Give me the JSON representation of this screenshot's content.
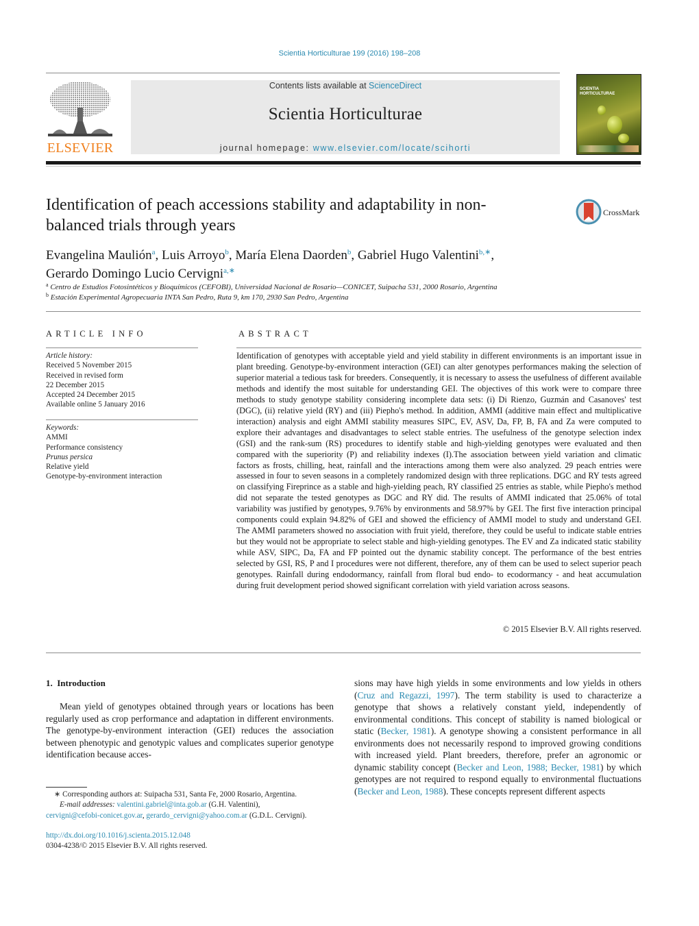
{
  "header": {
    "journal_reference": "Scientia Horticulturae 199 (2016) 198–208",
    "contents_prefix": "Contents lists available at ",
    "contents_link": "ScienceDirect",
    "journal_title": "Scientia Horticulturae",
    "homepage_prefix": "journal homepage: ",
    "homepage_link": "www.elsevier.com/locate/scihorti",
    "publisher_logo_text": "ELSEVIER",
    "cover_title": "SCIENTIA HORTICULTURAE",
    "brand_color": "#f07f1b",
    "link_color": "#2a8ab0"
  },
  "article": {
    "title": "Identification of peach accessions stability and adaptability in non-balanced trials through years",
    "crossmark_label": "CrossMark",
    "authors": [
      {
        "name": "Evangelina Maulión",
        "sup": "a"
      },
      {
        "name": "Luis Arroyo",
        "sup": "b"
      },
      {
        "name": "María Elena Daorden",
        "sup": "b"
      },
      {
        "name": "Gabriel Hugo Valentini",
        "sup": "b,∗"
      },
      {
        "name": "Gerardo Domingo Lucio Cervigni",
        "sup": "a,∗"
      }
    ],
    "affiliations": [
      {
        "mark": "a",
        "text": "Centro de Estudios Fotosintéticos y Bioquímicos (CEFOBI), Universidad Nacional de Rosario—CONICET, Suipacha 531, 2000 Rosario, Argentina"
      },
      {
        "mark": "b",
        "text": "Estación Experimental Agropecuaria INTA San Pedro, Ruta 9, km 170, 2930 San Pedro, Argentina"
      }
    ]
  },
  "article_info": {
    "heading": "ARTICLE INFO",
    "history_label": "Article history:",
    "history": [
      "Received 5 November 2015",
      "Received in revised form",
      "22 December 2015",
      "Accepted 24 December 2015",
      "Available online 5 January 2016"
    ],
    "keywords_label": "Keywords:",
    "keywords": [
      {
        "text": "AMMI",
        "italic": false
      },
      {
        "text": "Performance consistency",
        "italic": false
      },
      {
        "text": "Prunus persica",
        "italic": true
      },
      {
        "text": "Relative yield",
        "italic": false
      },
      {
        "text": "Genotype-by-environment interaction",
        "italic": false
      }
    ]
  },
  "abstract": {
    "heading": "ABSTRACT",
    "text": "Identification of genotypes with acceptable yield and yield stability in different environments is an important issue in plant breeding. Genotype-by-environment interaction (GEI) can alter genotypes per­formances making the selection of superior material a tedious task for breeders. Consequently, it is necessary to assess the usefulness of different available methods and identify the most suitable for under­standing GEI. The objectives of this work were to compare three methods to study genotype stability considering incomplete data sets: (i) Di Rienzo, Guzmán and Casanoves' test (DGC), (ii) relative yield (RY) and (iii) Piepho's method. In addition, AMMI (additive main effect and multiplicative interaction) analysis and eight AMMI stability measures SIPC, EV, ASV, Da, FP, B, FA and Za were computed to explore their advantages and disadvantages to select stable entries. The usefulness of the genotype selection index (GSI) and the rank-sum (RS) procedures to identify stable and high-yielding genotypes were evaluated and then compared with the superiority (P) and reliability indexes (I).The association between yield vari­ation and climatic factors as frosts, chilling, heat, rainfall and the interactions among them were also analyzed. 29 peach entries were assessed in four to seven seasons in a completely randomized design with three replications. DGC and RY tests agreed on classifying Fireprince as a stable and high-yielding peach, RY classified 25 entries as stable, while Piepho's method did not separate the tested genotypes as DGC and RY did. The results of AMMI indicated that 25.06% of total variability was justified by genotypes, 9.76% by environments and 58.97% by GEI. The first five interaction principal components could explain 94.82% of GEI and showed the efficiency of AMMI model to study and understand GEI. The AMMI param­eters showed no association with fruit yield, therefore, they could be useful to indicate stable entries but they would not be appropriate to select stable and high-yielding genotypes. The EV and Za indicated static stability while ASV, SIPC, Da, FA and FP pointed out the dynamic stability concept. The performance of the best entries selected by GSI, RS, P and I procedures were not different, therefore, any of them can be used to select superior peach genotypes. Rainfall during endodormancy, rainfall from floral bud endo- to ecodormancy - and heat accumulation during fruit development period showed significant correlation with yield variation across seasons.",
    "copyright": "© 2015 Elsevier B.V. All rights reserved."
  },
  "introduction": {
    "heading": "1.  Introduction",
    "left_column": "Mean yield of genotypes obtained through years or locations has been regularly used as crop performance and adaptation in differ­ent environments. The genotype-by-environment interaction (GEI) reduces the association between phenotypic and genotypic values and complicates superior genotype identification because acces-",
    "right_column": [
      {
        "t": "sions may have high yields in some environments and low yields in others ("
      },
      {
        "t": "Cruz and Regazzi, 1997",
        "link": true
      },
      {
        "t": "). The term stability is used to characterize a genotype that shows a relatively constant yield, inde­pendently of environmental conditions. This concept of stability is named biological or static ("
      },
      {
        "t": "Becker, 1981",
        "link": true
      },
      {
        "t": "). A genotype showing a consistent performance in all environments does not necessar­ily respond to improved growing conditions with increased yield. Plant breeders, therefore, prefer an agronomic or dynamic stability concept ("
      },
      {
        "t": "Becker and Leon, 1988; Becker, 1981",
        "link": true
      },
      {
        "t": ") by which genotypes are not required to respond equally to environmental fluctuations ("
      },
      {
        "t": "Becker and Leon, 1988",
        "link": true
      },
      {
        "t": "). These concepts represent different aspects"
      }
    ]
  },
  "footnotes": {
    "corresponding_mark": "∗",
    "corresponding_text": "Corresponding authors at: Suipacha 531, Santa Fe, 2000 Rosario, Argentina.",
    "email_label": "E-mail addresses:",
    "emails": [
      {
        "address": "valentini.gabriel@inta.gob.ar",
        "owner": " (G.H. Valentini),"
      },
      {
        "address": "cervigni@cefobi-conicet.gov.ar",
        "owner": ", "
      },
      {
        "address": "gerardo_cervigni@yahoo.com.ar",
        "owner": " (G.D.L. Cervigni)."
      }
    ],
    "doi_link": "http://dx.doi.org/10.1016/j.scienta.2015.12.048",
    "issn_line": "0304-4238/© 2015 Elsevier B.V. All rights reserved."
  }
}
